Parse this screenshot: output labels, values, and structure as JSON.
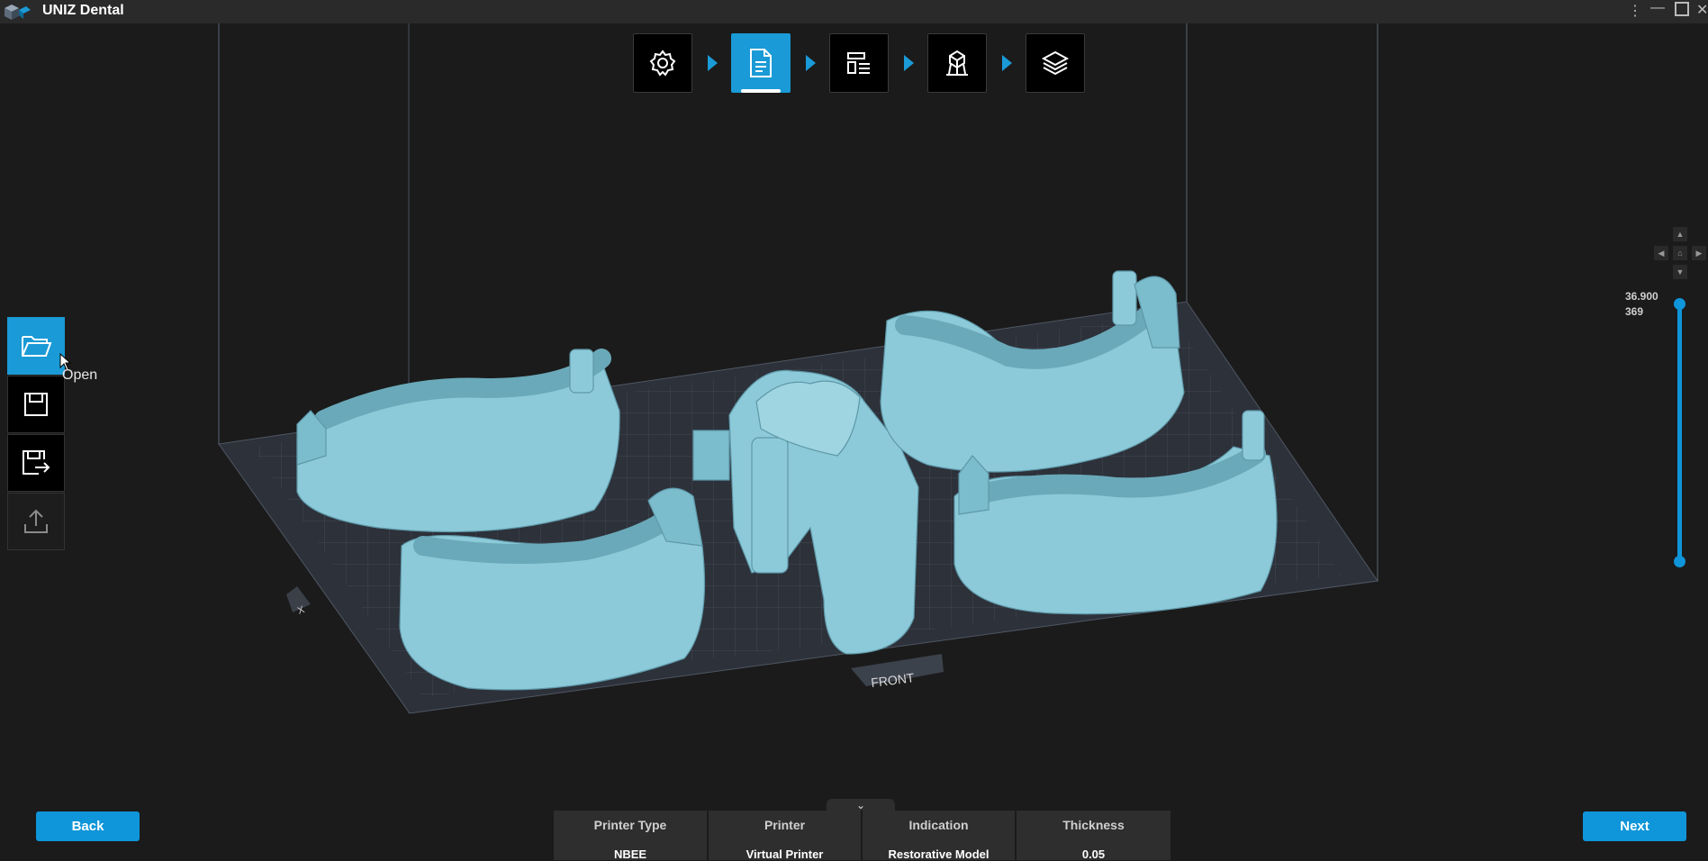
{
  "app": {
    "title": "UNIZ Dental"
  },
  "workflow_steps": [
    {
      "name": "settings",
      "icon": "gear-icon"
    },
    {
      "name": "file",
      "icon": "document-icon",
      "active": true
    },
    {
      "name": "layout",
      "icon": "layout-icon"
    },
    {
      "name": "support",
      "icon": "support-icon"
    },
    {
      "name": "slice",
      "icon": "layers-icon"
    }
  ],
  "side_toolbar": {
    "open_tooltip": "Open",
    "items": [
      {
        "name": "open",
        "icon": "folder-open-icon",
        "active": true
      },
      {
        "name": "save",
        "icon": "save-icon"
      },
      {
        "name": "save-as",
        "icon": "save-as-icon"
      },
      {
        "name": "export",
        "icon": "upload-icon",
        "disabled": true
      }
    ]
  },
  "scene": {
    "front_label": "FRONT",
    "axis_label": "X"
  },
  "layer_slider": {
    "height": "36.900",
    "layer": "369",
    "level": 1.0
  },
  "buttons": {
    "back": "Back",
    "next": "Next"
  },
  "info_table": {
    "headers": [
      "Printer Type",
      "Printer",
      "Indication",
      "Thickness"
    ],
    "values": [
      "NBEE",
      "Virtual Printer",
      "Restorative Model",
      "0.05"
    ]
  },
  "colors": {
    "accent": "#1a9ad6",
    "model": "#8ccad9",
    "background": "#1b1b1b"
  }
}
